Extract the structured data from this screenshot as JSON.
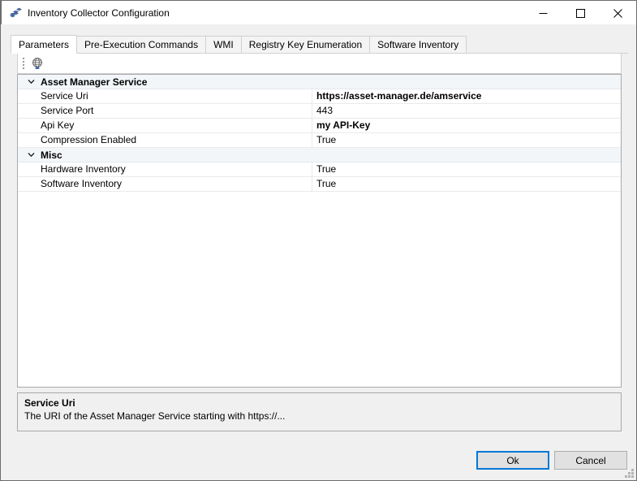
{
  "window": {
    "title": "Inventory Collector Configuration",
    "icon": "app-blocks-icon",
    "minimize_label": "Minimize",
    "maximize_label": "Maximize",
    "close_label": "Close"
  },
  "tabs": [
    {
      "label": "Parameters",
      "selected": true
    },
    {
      "label": "Pre-Execution Commands",
      "selected": false
    },
    {
      "label": "WMI",
      "selected": false
    },
    {
      "label": "Registry Key Enumeration",
      "selected": false
    },
    {
      "label": "Software Inventory",
      "selected": false
    }
  ],
  "toolbar": {
    "buttons": [
      {
        "icon": "globe-icon",
        "label": "Globe"
      }
    ]
  },
  "property_grid": {
    "rows": [
      {
        "type": "category",
        "name": "Asset Manager Service",
        "expanded": true,
        "value": ""
      },
      {
        "type": "property",
        "name": "Service Uri",
        "value": "https://asset-manager.de/amservice",
        "bold": true
      },
      {
        "type": "property",
        "name": "Service Port",
        "value": "443",
        "bold": false
      },
      {
        "type": "property",
        "name": "Api Key",
        "value": "my API-Key",
        "bold": true
      },
      {
        "type": "property",
        "name": "Compression Enabled",
        "value": "True",
        "bold": false
      },
      {
        "type": "category",
        "name": "Misc",
        "expanded": true,
        "value": ""
      },
      {
        "type": "property",
        "name": "Hardware Inventory",
        "value": "True",
        "bold": false
      },
      {
        "type": "property",
        "name": "Software Inventory",
        "value": "True",
        "bold": false
      }
    ]
  },
  "description": {
    "title": "Service Uri",
    "text": "The URI of the Asset Manager Service starting with https://..."
  },
  "footer": {
    "ok_label": "Ok",
    "cancel_label": "Cancel"
  },
  "colors": {
    "accent": "#0078d7",
    "window_bg": "#f0f0f0",
    "grid_bg": "#ffffff",
    "category_bg": "#f3f6f9",
    "border": "#a9a9a9"
  }
}
